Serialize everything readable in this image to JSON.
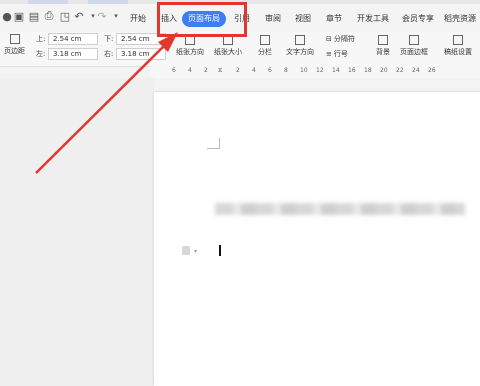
{
  "ribbon_tabs": [
    "开始",
    "插入",
    "页面布局",
    "引用",
    "审阅",
    "视图",
    "章节",
    "开发工具",
    "会员专享",
    "稻壳资源"
  ],
  "active_tab": "页面布局",
  "margins": {
    "top_label": "上:",
    "top_value": "2.54 cm",
    "bottom_label": "下:",
    "bottom_value": "2.54 cm",
    "left_label": "左:",
    "left_value": "3.18 cm",
    "right_label": "右:",
    "right_value": "3.18 cm",
    "margins_button": "页边距"
  },
  "ribbon_buttons": {
    "orientation": "纸张方向",
    "size": "纸张大小",
    "columns": "分栏",
    "text_direction": "文字方向",
    "separator": "分隔符",
    "line_number": "行号",
    "background": "背景",
    "page_border": "页面边框",
    "manuscript": "稿纸设置"
  },
  "ruler_numbers": [
    "6",
    "4",
    "2",
    "2",
    "4",
    "6",
    "8",
    "10",
    "12",
    "14",
    "16",
    "18",
    "20",
    "22",
    "24",
    "26"
  ],
  "colors": {
    "accent": "#3d7ef5",
    "highlight": "#e0382f"
  }
}
